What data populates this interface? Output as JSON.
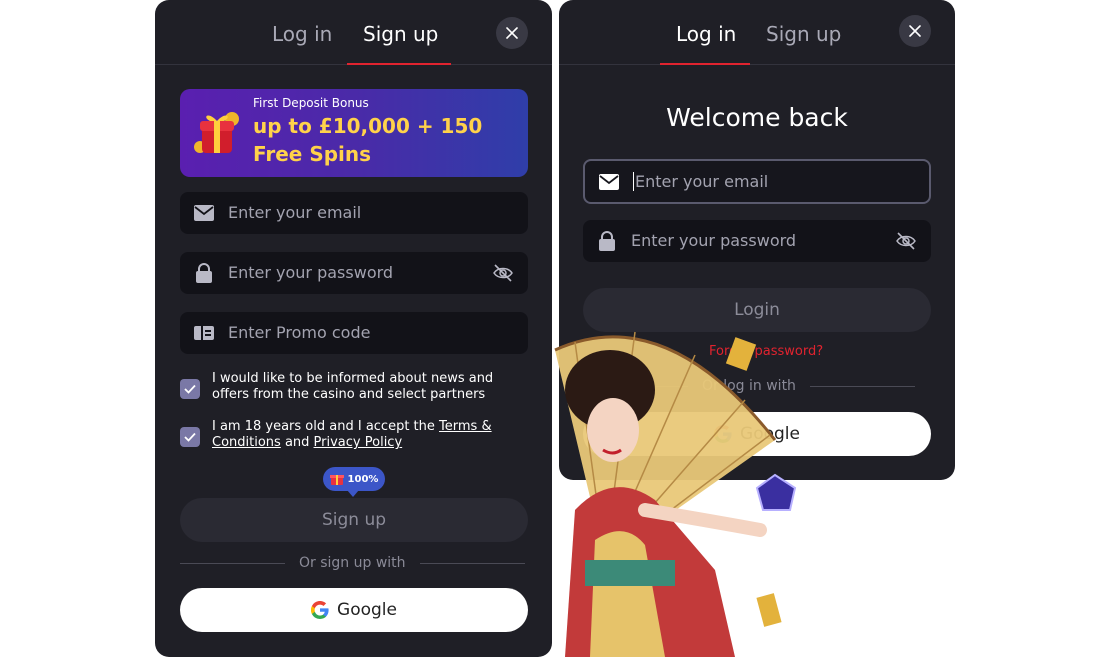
{
  "signup": {
    "tabs": {
      "login": "Log in",
      "signup": "Sign up"
    },
    "bonus": {
      "subtitle": "First Deposit Bonus",
      "title": "up to £10,000 + 150 Free Spins"
    },
    "email_placeholder": "Enter your email",
    "password_placeholder": "Enter your password",
    "promo_placeholder": "Enter Promo code",
    "consent_news": "I would like to be informed about news and offers from the casino and select partners",
    "consent_age_prefix": "I am 18 years old and I accept the ",
    "terms_link": "Terms & Conditions",
    "consent_and": " and ",
    "privacy_link": "Privacy Policy",
    "progress_badge": "100%",
    "signup_button": "Sign up",
    "divider": "Or sign up with",
    "google_button": "Google"
  },
  "login": {
    "tabs": {
      "login": "Log in",
      "signup": "Sign up"
    },
    "heading": "Welcome back",
    "email_placeholder": "Enter your email",
    "password_placeholder": "Enter your password",
    "login_button": "Login",
    "forgot": "Forgot password?",
    "divider": "Or log in with",
    "google_button": "Google"
  },
  "colors": {
    "accent": "#e0232f",
    "panel": "#1f1f26",
    "field": "#121218",
    "bonus_text": "#ffd24a"
  },
  "icons": [
    "close-icon",
    "mail-icon",
    "lock-icon",
    "eye-off-icon",
    "promo-icon",
    "check-icon",
    "gift-icon",
    "google-icon"
  ]
}
